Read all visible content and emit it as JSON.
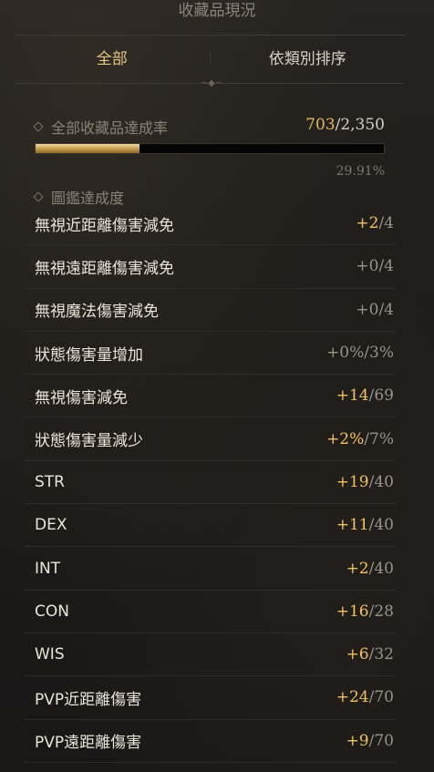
{
  "header": {
    "title": "收藏品現況"
  },
  "tabs": [
    {
      "label": "全部",
      "active": true
    },
    {
      "label": "依類別排序",
      "active": false
    }
  ],
  "summary": {
    "label": "全部收藏品達成率",
    "current": "703",
    "max": "2,350",
    "percent": "29.91%",
    "progress": 0.2991
  },
  "codex": {
    "label": "圖鑑達成度"
  },
  "stats": [
    {
      "name": "無視近距離傷害減免",
      "bonus": "+2",
      "max": "4",
      "positive": true
    },
    {
      "name": "無視遠距離傷害減免",
      "bonus": "+0",
      "max": "4",
      "positive": false
    },
    {
      "name": "無視魔法傷害減免",
      "bonus": "+0",
      "max": "4",
      "positive": false
    },
    {
      "name": "狀態傷害量增加",
      "bonus": "+0%",
      "max": "3%",
      "positive": false
    },
    {
      "name": "無視傷害減免",
      "bonus": "+14",
      "max": "69",
      "positive": true
    },
    {
      "name": "狀態傷害量減少",
      "bonus": "+2%",
      "max": "7%",
      "positive": true
    },
    {
      "name": "STR",
      "bonus": "+19",
      "max": "40",
      "positive": true
    },
    {
      "name": "DEX",
      "bonus": "+11",
      "max": "40",
      "positive": true
    },
    {
      "name": "INT",
      "bonus": "+2",
      "max": "40",
      "positive": true
    },
    {
      "name": "CON",
      "bonus": "+16",
      "max": "28",
      "positive": true
    },
    {
      "name": "WIS",
      "bonus": "+6",
      "max": "32",
      "positive": true
    },
    {
      "name": "PVP近距離傷害",
      "bonus": "+24",
      "max": "70",
      "positive": true
    },
    {
      "name": "PVP遠距離傷害",
      "bonus": "+9",
      "max": "70",
      "positive": true
    }
  ],
  "colors": {
    "accent": "#e6c787",
    "positive": "#f2c165",
    "muted": "#9a9488"
  }
}
